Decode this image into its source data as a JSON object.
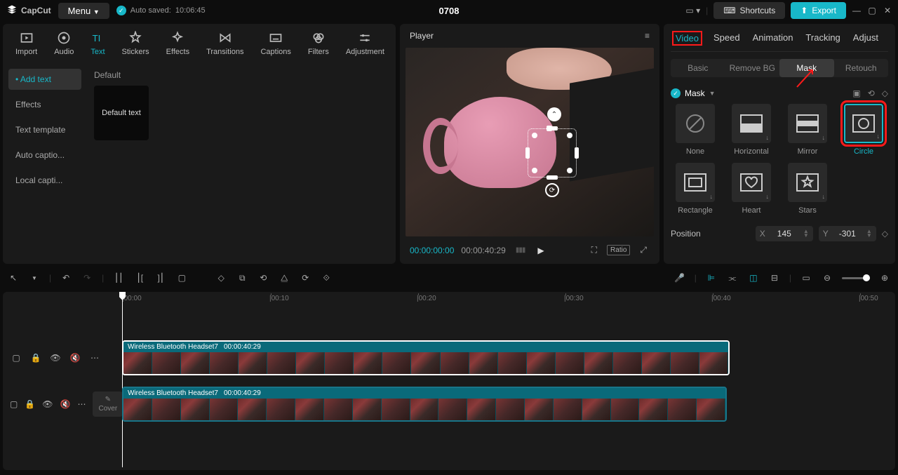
{
  "app": {
    "name": "CapCut",
    "menu": "Menu",
    "autosave_prefix": "Auto saved:",
    "autosave_time": "10:06:45",
    "project": "0708"
  },
  "top_right": {
    "shortcuts": "Shortcuts",
    "export": "Export"
  },
  "left_tabs": {
    "import": "Import",
    "audio": "Audio",
    "text": "Text",
    "stickers": "Stickers",
    "effects": "Effects",
    "transitions": "Transitions",
    "captions": "Captions",
    "filters": "Filters",
    "adjustment": "Adjustment"
  },
  "sidebar": {
    "items": [
      {
        "label": "Add text",
        "active": true
      },
      {
        "label": "Effects"
      },
      {
        "label": "Text template"
      },
      {
        "label": "Auto captio..."
      },
      {
        "label": "Local capti..."
      }
    ]
  },
  "content": {
    "default_label": "Default",
    "default_text": "Default text"
  },
  "player": {
    "title": "Player",
    "cur": "00:00:00:00",
    "total": "00:00:40:29",
    "ratio": "Ratio"
  },
  "right_tabs": [
    "Video",
    "Speed",
    "Animation",
    "Tracking",
    "Adjust"
  ],
  "right_sub": [
    "Basic",
    "Remove BG",
    "Mask",
    "Retouch"
  ],
  "mask": {
    "label": "Mask",
    "items": [
      "None",
      "Horizontal",
      "Mirror",
      "Circle",
      "Rectangle",
      "Heart",
      "Stars"
    ]
  },
  "position": {
    "label": "Position",
    "x_label": "X",
    "x_val": "145",
    "y_label": "Y",
    "y_val": "-301"
  },
  "timeline": {
    "marks": [
      "00:00",
      "00:10",
      "00:20",
      "00:30",
      "00:40",
      "00:50"
    ],
    "cover": "Cover",
    "clip_name": "Wireless Bluetooth Headset7",
    "clip_time": "00:00:40:29"
  }
}
